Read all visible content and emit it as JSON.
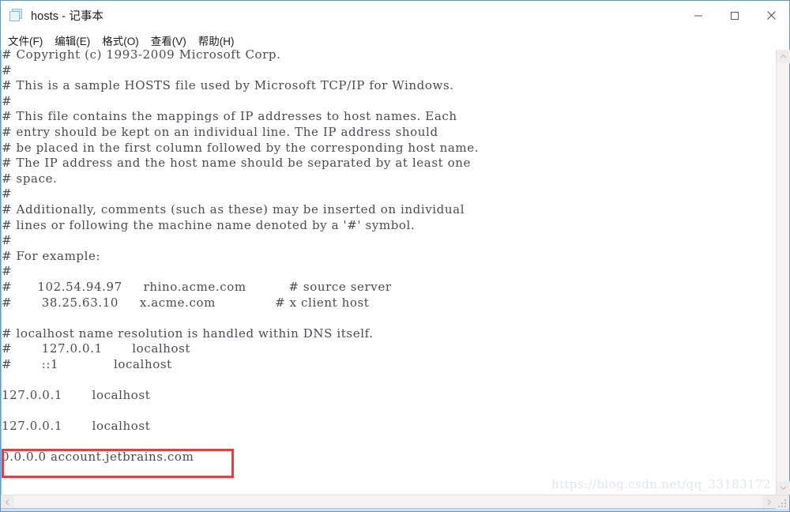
{
  "window": {
    "title": "hosts - 记事本",
    "app_icon": "notepad-icon",
    "controls": {
      "minimize_label": "最小化",
      "maximize_label": "最大化",
      "close_label": "关闭"
    }
  },
  "menu": {
    "items": [
      {
        "label": "文件(F)"
      },
      {
        "label": "编辑(E)"
      },
      {
        "label": "格式(O)"
      },
      {
        "label": "查看(V)"
      },
      {
        "label": "帮助(H)"
      }
    ]
  },
  "editor": {
    "content": "# Copyright (c) 1993-2009 Microsoft Corp.\n#\n# This is a sample HOSTS file used by Microsoft TCP/IP for Windows.\n#\n# This file contains the mappings of IP addresses to host names. Each\n# entry should be kept on an individual line. The IP address should\n# be placed in the first column followed by the corresponding host name.\n# The IP address and the host name should be separated by at least one\n# space.\n#\n# Additionally, comments (such as these) may be inserted on individual\n# lines or following the machine name denoted by a '#' symbol.\n#\n# For example:\n#\n#      102.54.94.97     rhino.acme.com          # source server\n#       38.25.63.10     x.acme.com              # x client host\n\n# localhost name resolution is handled within DNS itself.\n#       127.0.0.1       localhost\n#       ::1             localhost\n\n127.0.0.1       localhost\n\n127.0.0.1       localhost\n\n0.0.0.0 account.jetbrains.com",
    "highlighted_line": "0.0.0.0 account.jetbrains.com",
    "highlight_color": "#ef3b3b"
  },
  "watermark": {
    "text": "https://blog.csdn.net/qq_33183172"
  },
  "scrollbars": {
    "vertical": {
      "up_arrow": "chevron-up-icon",
      "down_arrow": "chevron-down-icon"
    },
    "horizontal": {
      "left_arrow": "chevron-left-icon",
      "right_arrow": "chevron-right-icon"
    }
  }
}
